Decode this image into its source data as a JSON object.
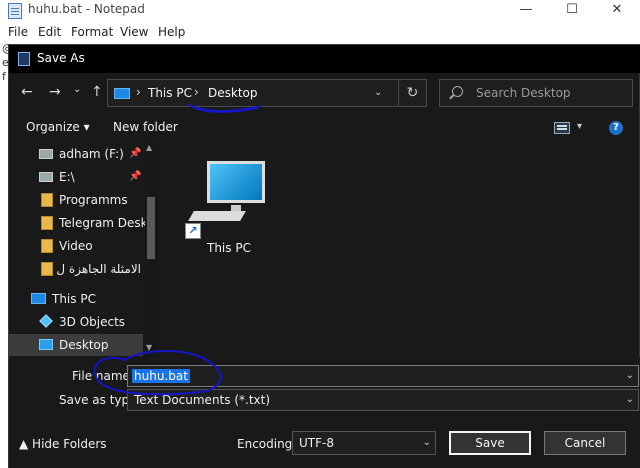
{
  "notepad": {
    "title": "huhu.bat - Notepad",
    "menu": [
      "File",
      "Edit",
      "Format",
      "View",
      "Help"
    ],
    "window_buttons": {
      "minimize": "—",
      "maximize": "☐",
      "close": "✕"
    },
    "edge_chars": [
      "@",
      "e",
      "f"
    ]
  },
  "dialog": {
    "title": "Save As",
    "nav": {
      "back": "←",
      "forward": "→",
      "recent": "⌄",
      "up": "↑"
    },
    "address": {
      "crumbs": [
        "This PC",
        "Desktop"
      ],
      "separator": "›",
      "dropdown": "⌄",
      "refresh": "↻"
    },
    "search": {
      "placeholder": "Search Desktop"
    },
    "toolbar": {
      "organize": "Organize ▾",
      "new_folder": "New folder",
      "help": "?",
      "view_dropdown": "▾"
    },
    "tree": [
      {
        "label": "adham (F:)",
        "icon": "drive-icon",
        "pinned": true
      },
      {
        "label": "E:\\",
        "icon": "drive-icon",
        "pinned": true
      },
      {
        "label": "Programms",
        "icon": "folder-icon",
        "pinned": false
      },
      {
        "label": "Telegram Deskto",
        "icon": "folder-icon",
        "pinned": false
      },
      {
        "label": "Video",
        "icon": "folder-icon",
        "pinned": false
      },
      {
        "label": "الامثلة الجاهزة  ل",
        "icon": "folder-icon",
        "pinned": false
      },
      {
        "label": "This PC",
        "icon": "pc-icon",
        "pinned": false
      },
      {
        "label": "3D Objects",
        "icon": "cube-icon",
        "pinned": false
      },
      {
        "label": "Desktop",
        "icon": "desktop-icon",
        "pinned": false,
        "selected": true
      }
    ],
    "pin_glyph": "📌",
    "content_items": [
      {
        "label": "This PC",
        "icon": "computer-icon"
      }
    ],
    "shortcut_glyph": "↗",
    "file_name": {
      "label": "File name:",
      "value": "huhu.bat"
    },
    "save_as_type": {
      "label": "Save as type:",
      "value": "Text Documents (*.txt)"
    },
    "hide_folders": "▲  Hide Folders",
    "encoding": {
      "label": "Encoding:",
      "value": "UTF-8"
    },
    "buttons": {
      "save": "Save",
      "cancel": "Cancel"
    },
    "dropdown_glyph": "⌄"
  },
  "colors": {
    "dialog_bg": "#191919",
    "accent": "#1a73e8",
    "annotation": "#1414c8"
  }
}
